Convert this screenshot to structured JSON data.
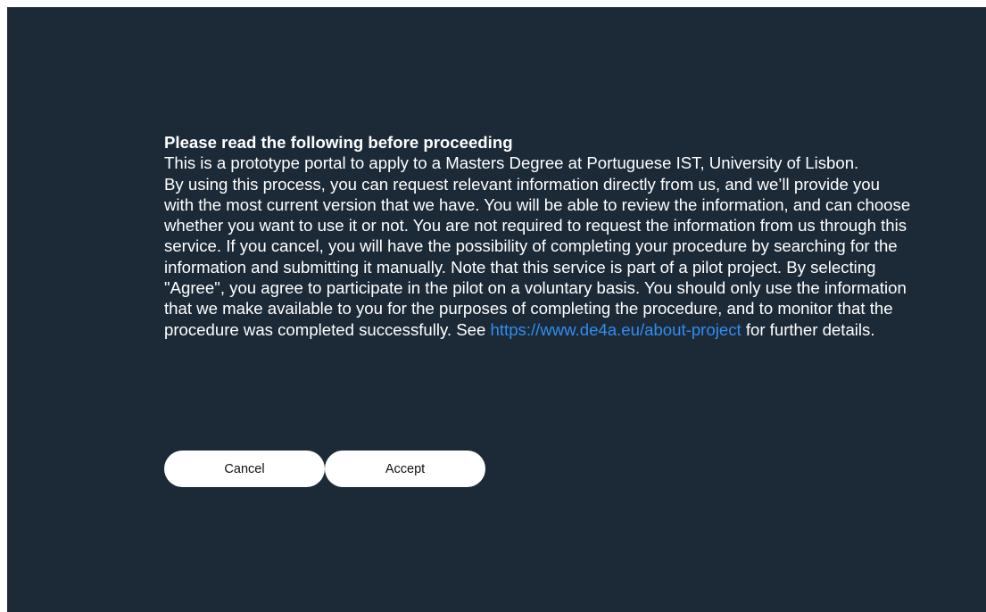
{
  "notice": {
    "heading": "Please read the following before proceeding",
    "intro": "This is a prototype portal to apply to a Masters Degree at Portuguese IST, University of Lisbon.",
    "body_before_link": "By using this process, you can request relevant information directly from us, and we’ll provide you with the most current version that we have. You will be able to review the information, and can choose whether you want to use it or not. You are not required to request the information from us through this service. If you cancel, you will have the possibility of completing your procedure by searching for the information and submitting it manually. Note that this service is part of a pilot project. By selecting \"Agree\", you agree to participate in the pilot on a voluntary basis. You should only use the information that we make available to you for the purposes of completing the procedure, and to monitor that the procedure was completed successfully. See ",
    "link_text": "https://www.de4a.eu/about-project",
    "body_after_link": " for further details."
  },
  "actions": {
    "cancel_label": "Cancel",
    "accept_label": "Accept"
  },
  "colors": {
    "background": "#1c2a38",
    "text": "#ffffff",
    "link": "#2f8df0",
    "button_bg": "#ffffff"
  }
}
